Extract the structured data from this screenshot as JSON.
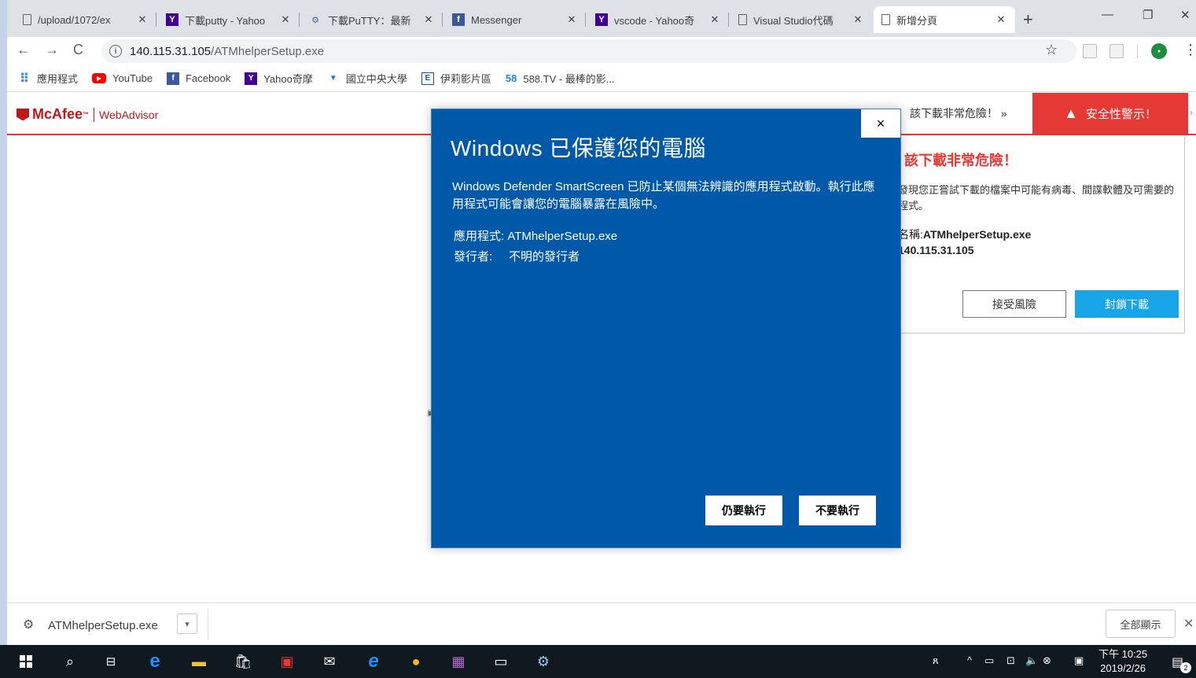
{
  "tabs": [
    {
      "title": "/upload/1072/ex",
      "icon": "document-icon"
    },
    {
      "title": "下載putty - Yahoo",
      "icon": "yahoo-icon"
    },
    {
      "title": "下載PuTTY：最新",
      "icon": "putty-icon"
    },
    {
      "title": "Messenger",
      "icon": "facebook-icon"
    },
    {
      "title": "vscode - Yahoo奇",
      "icon": "yahoo-icon"
    },
    {
      "title": "Visual Studio代碼",
      "icon": "document-icon"
    },
    {
      "title": "新增分頁",
      "icon": "document-icon"
    }
  ],
  "address": {
    "host": "140.115.31.105",
    "path": "/ATMhelperSetup.exe"
  },
  "bookmarks": {
    "apps": "應用程式",
    "youtube": "YouTube",
    "facebook": "Facebook",
    "yahoo": "Yahoo奇摩",
    "ncu": "國立中央大學",
    "iri": "伊莉影片區",
    "tv588": "588.TV - 最棒的影..."
  },
  "mcafee": {
    "brand": "McAfee",
    "product": "WebAdvisor",
    "banner_message": "該下載非常危險！ »",
    "alert": "安全性警示！",
    "panel_title": "該下載非常危險！",
    "panel_body": "發現您正嘗試下載的檔案中可能有病毒、間諜軟體及可需要的程式。",
    "file_label": "名稱:",
    "file_name": "ATMhelperSetup.exe",
    "source": "140.115.31.105",
    "accept_button": "接受風險",
    "block_button": "封鎖下載"
  },
  "dialog": {
    "title": "Windows 已保護您的電腦",
    "message": "Windows Defender SmartScreen 已防止某個無法辨識的應用程式啟動。執行此應用程式可能會讓您的電腦暴露在風險中。",
    "app_label": "應用程式:",
    "app_value": "ATMhelperSetup.exe",
    "publisher_label": "發行者:",
    "publisher_value": "不明的發行者",
    "run_anyway": "仍要執行",
    "dont_run": "不要執行",
    "close": "×"
  },
  "download": {
    "file": "ATMhelperSetup.exe",
    "show_all": "全部顯示"
  },
  "clock": {
    "time": "下午 10:25",
    "date": "2019/2/26"
  },
  "notifications_count": "2",
  "colors": {
    "dialog_bg": "#0058a8",
    "mcafee_red": "#e53935",
    "block_blue": "#17a5e8",
    "taskbar": "#101820"
  }
}
